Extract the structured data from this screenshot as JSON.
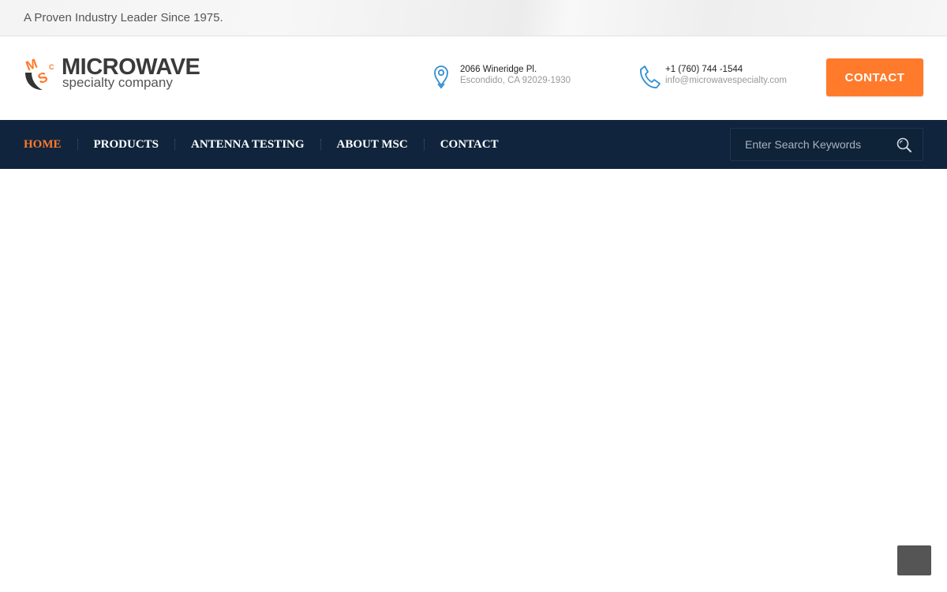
{
  "topbar": {
    "tagline": "A Proven Industry Leader Since 1975."
  },
  "logo": {
    "main": "MICROWAVE",
    "sub": "specialty company",
    "mark_letters": "MSC"
  },
  "contact_info": {
    "address": {
      "icon": "map-pin-icon",
      "line1": "2066 Wineridge Pl.",
      "line2": "Escondido, CA 92029-1930"
    },
    "phone": {
      "icon": "phone-icon",
      "line1": "+1 (760) 744 -1544",
      "line2": "info@microwavespecialty.com"
    }
  },
  "header": {
    "cta_label": "CONTACT"
  },
  "nav": {
    "items": [
      {
        "label": "HOME",
        "active": true
      },
      {
        "label": "PRODUCTS"
      },
      {
        "label": "ANTENNA TESTING"
      },
      {
        "label": "ABOUT MSC"
      },
      {
        "label": "CONTACT"
      }
    ],
    "search_placeholder": "Enter Search Keywords",
    "search_value": ""
  },
  "colors": {
    "accent": "#ff7a2b",
    "nav_bg": "#10253d",
    "icon_blue": "#2f8fd0",
    "logo_dark": "#3a3a3a"
  }
}
